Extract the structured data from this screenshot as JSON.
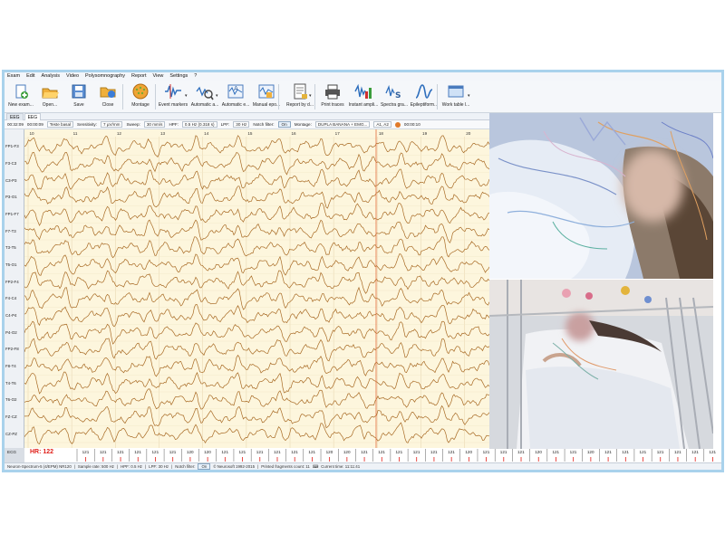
{
  "menu": [
    "Exam",
    "Edit",
    "Analysis",
    "Video",
    "Polysomnography",
    "Report",
    "View",
    "Settings",
    "?"
  ],
  "toolbar": {
    "buttons": [
      {
        "label": "New exam...",
        "icon": "new-exam-icon"
      },
      {
        "label": "Open...",
        "icon": "open-folder-icon"
      },
      {
        "label": "Save",
        "icon": "save-disk-icon"
      },
      {
        "label": "Close",
        "icon": "close-folder-icon"
      },
      {
        "label": "Montage",
        "icon": "montage-head-icon"
      },
      {
        "label": "Event markers",
        "icon": "event-markers-icon"
      },
      {
        "label": "Automatic a...",
        "icon": "automatic-analysis-icon"
      },
      {
        "label": "Automatic e...",
        "icon": "automatic-epochs-icon"
      },
      {
        "label": "Manual epo...",
        "icon": "manual-epochs-icon"
      },
      {
        "label": "Report by d...",
        "icon": "report-document-icon"
      },
      {
        "label": "Print traces",
        "icon": "printer-icon"
      },
      {
        "label": "Instant ampli...",
        "icon": "instant-amplitude-icon"
      },
      {
        "label": "Spectra gra...",
        "icon": "spectra-graph-icon"
      },
      {
        "label": "Epileptiform...",
        "icon": "epileptiform-icon"
      },
      {
        "label": "Work table l...",
        "icon": "work-table-icon"
      }
    ]
  },
  "tabs": [
    "EEG",
    "EEG"
  ],
  "status_row": {
    "time1": "00:32:09",
    "time2": "00:00:09",
    "test": "Teste basal",
    "sensitivity_label": "Sensitivity:",
    "sensitivity_value": "7 µV/mm",
    "sweep_label": "Sweep:",
    "sweep_value": "30 mm/s",
    "hpf_label": "HPF:",
    "hpf_value": "0.5 Hz (0.318 s)",
    "lpf_label": "LPF:",
    "lpf_value": "30 Hz",
    "notch_label": "Notch filter:",
    "notch_value": "On",
    "montage_label": "Montage:",
    "montage_value": "DUPLA BANANA + EMG...",
    "ref_value": "A1, A2",
    "duration_value": "00:00:10"
  },
  "time_ticks": [
    "10",
    "11",
    "12",
    "13",
    "14",
    "15",
    "16",
    "17",
    "18",
    "19",
    "20"
  ],
  "channels": [
    "FP1-F3",
    "F3-C3",
    "C3-P3",
    "P3-O1",
    "FP1-F7",
    "F7-T3",
    "T3-T5",
    "T5-O1",
    "FP2-F4",
    "F4-C4",
    "C4-P4",
    "P4-O2",
    "FP2-F8",
    "F8-T4",
    "T4-T6",
    "T6-O2",
    "FZ-CZ",
    "CZ-PZ"
  ],
  "ecg": {
    "label": "ECG",
    "hr_text": "HR: 122",
    "beat_values": [
      "121",
      "121",
      "121",
      "121",
      "121",
      "121",
      "120",
      "120",
      "121",
      "121",
      "121",
      "121",
      "121",
      "121",
      "120",
      "120",
      "121",
      "121",
      "121",
      "121",
      "121",
      "121",
      "120",
      "121",
      "121",
      "121",
      "120",
      "121",
      "121",
      "120",
      "121",
      "121",
      "121",
      "121",
      "121",
      "121",
      "121"
    ]
  },
  "statusbar": {
    "device": "Neuron-Spectrum-5 (4/EPM) NR120",
    "sample_rate": "Sample rate: 500 Hz",
    "hpf": "HPF: 0.5 Hz",
    "lpf": "LPF: 30 Hz",
    "notch_label": "Notch filter:",
    "notch_value": "On",
    "copyright": "© Neurosoft 1992-2015",
    "printed": "Printed fragments count: 11",
    "current_time": "Current time: 11:11:41"
  },
  "colors": {
    "frame": "#a9d2ec",
    "eeg_background": "#fdf6dd",
    "trace": "#a86a24",
    "gridline": "#ead9b4",
    "cursor": "#e06a3a",
    "hr_text": "#e0201a"
  }
}
